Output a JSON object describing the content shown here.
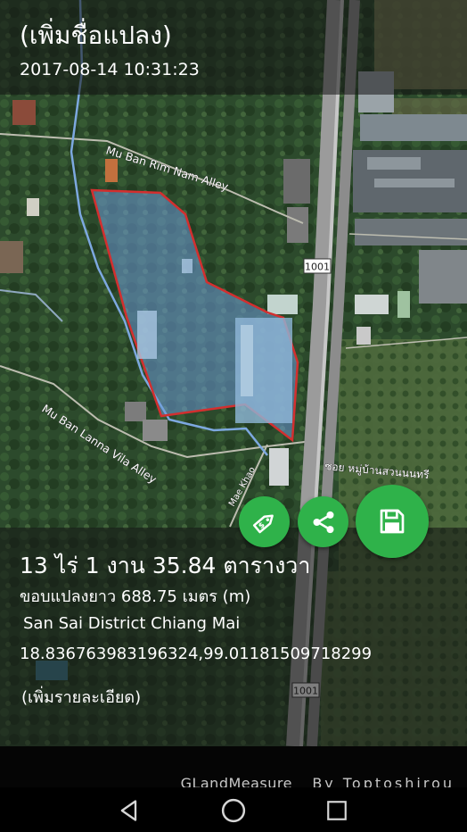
{
  "header": {
    "title": "(เพิ่มชื่อแปลง)",
    "timestamp": "2017-08-14 10:31:23"
  },
  "map": {
    "roads": {
      "rim_nam": "Mu Ban Rim Nam Alley",
      "lanna": "Mu Ban Lanna Vila Alley",
      "mae_khao": "Mae Khao",
      "soi_thai": "ซอย หมู่บ้านสวนนนทรี",
      "route_top": "1001",
      "route_bottom": "1001"
    },
    "plot_outline_color": "#d32f2f",
    "plot_fill_color": "#6e9bd8"
  },
  "info": {
    "area": "13 ไร่ 1 งาน 35.84 ตารางวา",
    "perimeter": "ขอบแปลงยาว 688.75 เมตร (m)",
    "location": "San Sai District Chiang Mai",
    "coordinates": "18.836763983196324,99.01181509718299",
    "details_link": "(เพิ่มรายละเอียด)"
  },
  "actions": {
    "price_icon": "price-tag-icon",
    "share_icon": "share-icon",
    "save_icon": "save-icon",
    "fab_color": "#2fb24a"
  },
  "footer": {
    "app_name": "GLandMeasure",
    "by_text": "By Toptoshirou"
  },
  "navbar": {
    "back_icon": "back-icon",
    "home_icon": "home-icon",
    "recent_icon": "recent-apps-icon"
  }
}
